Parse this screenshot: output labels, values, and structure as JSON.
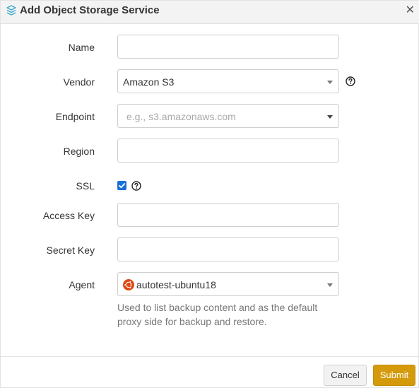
{
  "dialog": {
    "title": "Add Object Storage Service",
    "header_icon": "layers-icon",
    "close_icon": "close-icon",
    "close_glyph": "✕"
  },
  "form": {
    "name": {
      "label": "Name",
      "value": "",
      "placeholder": ""
    },
    "vendor": {
      "label": "Vendor",
      "value": "Amazon S3"
    },
    "endpoint": {
      "label": "Endpoint",
      "value": "",
      "placeholder": "e.g.,  s3.amazonaws.com"
    },
    "region": {
      "label": "Region",
      "value": "",
      "placeholder": ""
    },
    "ssl": {
      "label": "SSL",
      "checked": true
    },
    "access_key": {
      "label": "Access Key",
      "value": "",
      "placeholder": ""
    },
    "secret_key": {
      "label": "Secret Key",
      "value": "",
      "placeholder": ""
    },
    "agent": {
      "label": "Agent",
      "value": "autotest-ubuntu18",
      "icon": "ubuntu-logo-icon",
      "hint": "Used to list backup content and as the default proxy side for backup and restore."
    }
  },
  "footer": {
    "cancel_label": "Cancel",
    "submit_label": "Submit"
  },
  "colors": {
    "submit_bg": "#d49a0b",
    "checkbox": "#1a6fd8",
    "ubuntu": "#dd4814",
    "header_icon": "#3aa7c9"
  }
}
